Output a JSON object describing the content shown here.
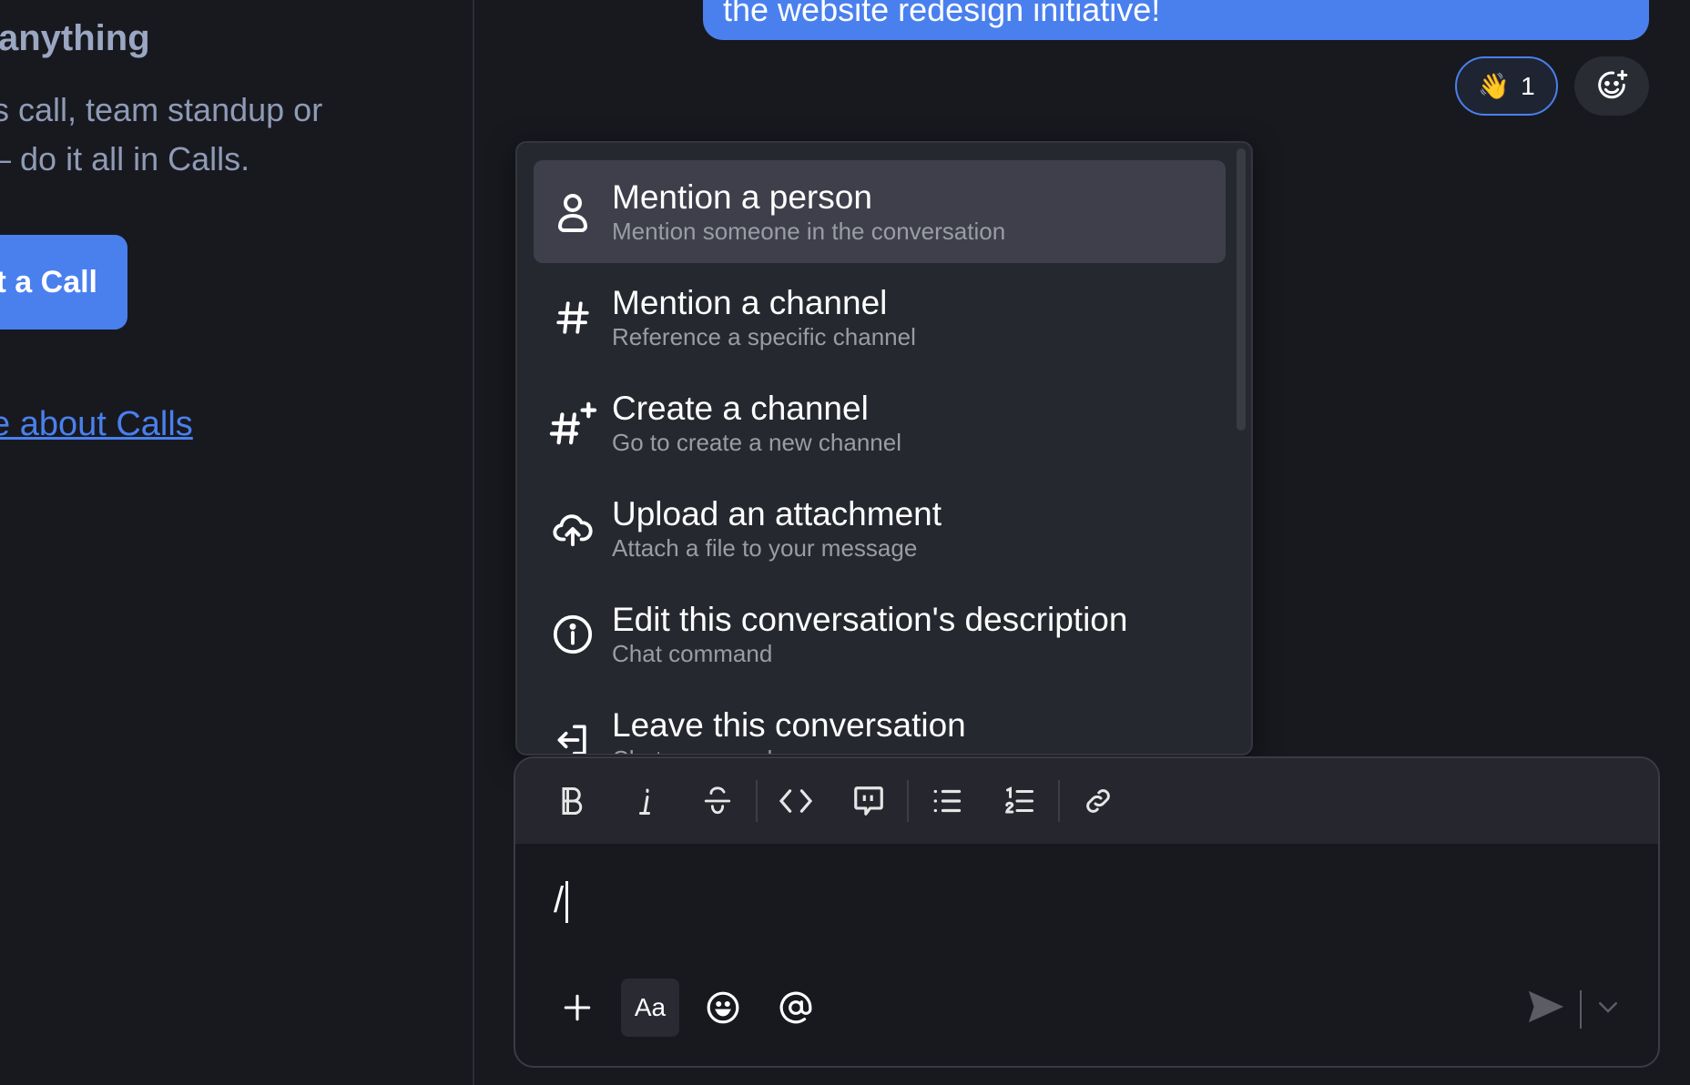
{
  "left_panel": {
    "heading": "anything",
    "body_line1": "s call, team standup or",
    "body_line2": "– do it all in Calls.",
    "call_button": "t a Call",
    "learn_link": "e about Calls"
  },
  "message": {
    "text": "the website redesign initiative!"
  },
  "reaction": {
    "emoji": "👋",
    "count": "1"
  },
  "menu": {
    "items": [
      {
        "title": "Mention a person",
        "subtitle": "Mention someone in the conversation",
        "icon": "person-icon",
        "selected": true
      },
      {
        "title": "Mention a channel",
        "subtitle": "Reference a specific channel",
        "icon": "hash-icon"
      },
      {
        "title": "Create a channel",
        "subtitle": "Go to create a new channel",
        "icon": "hash-plus-icon"
      },
      {
        "title": "Upload an attachment",
        "subtitle": "Attach a file to your message",
        "icon": "cloud-upload-icon"
      },
      {
        "title": "Edit this conversation's description",
        "subtitle": "Chat command",
        "icon": "info-icon"
      },
      {
        "title": "Leave this conversation",
        "subtitle": "Chat command",
        "icon": "leave-icon"
      }
    ]
  },
  "composer": {
    "value": "/",
    "format_toggle": "Aa"
  },
  "colors": {
    "accent": "#4a80ee",
    "background": "#18191f",
    "menu": "#262830",
    "selected": "#3e3f4a"
  }
}
